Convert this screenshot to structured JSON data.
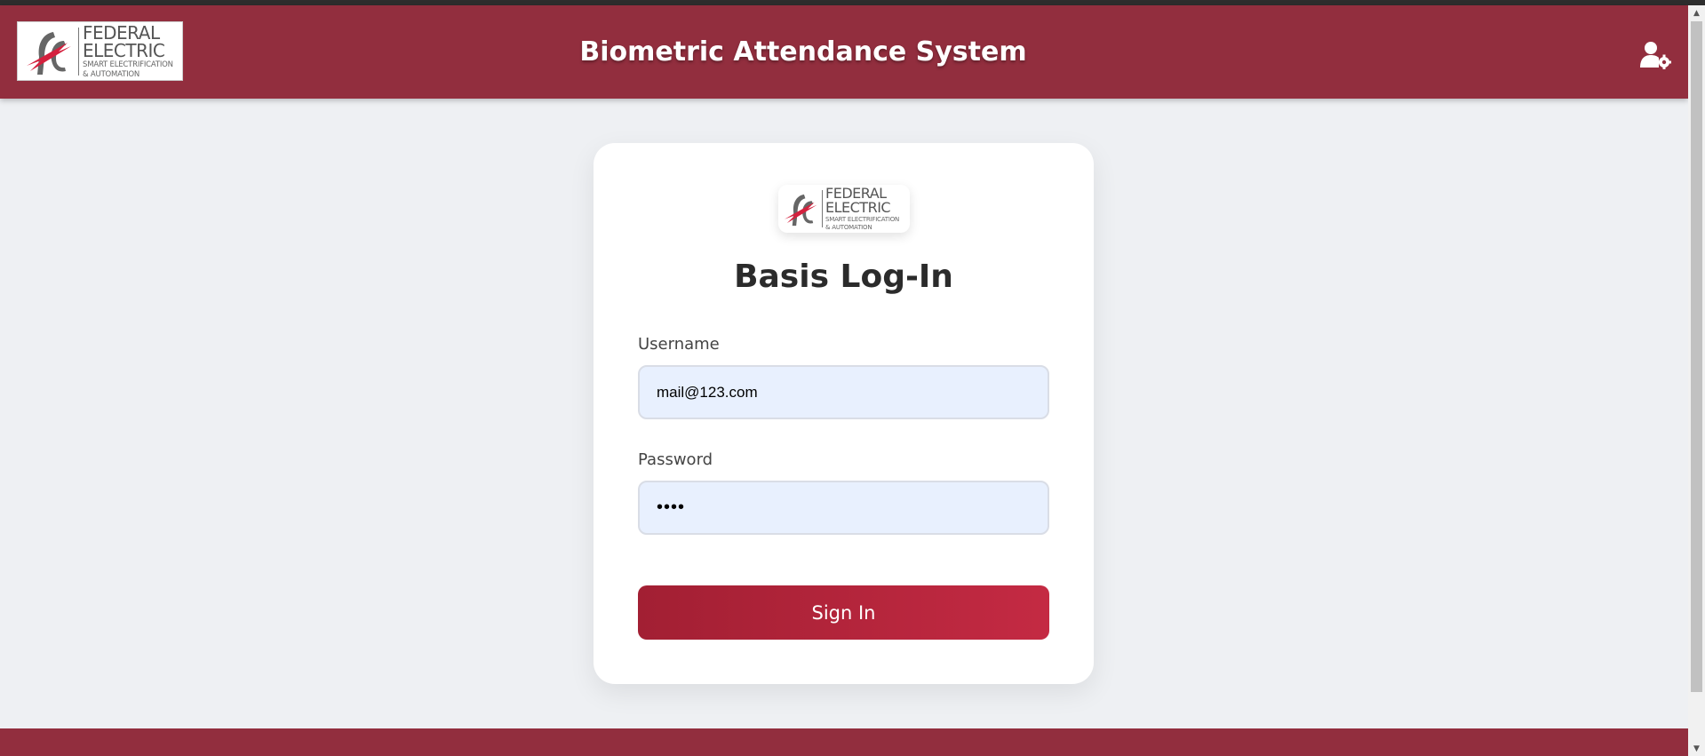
{
  "header": {
    "title": "Biometric Attendance System",
    "logo": {
      "title_line1": "FEDERAL",
      "title_line2": "ELECTRIC",
      "sub_line1": "SMART ELECTRIFICATION",
      "sub_line2": "& AUTOMATION"
    },
    "admin_icon": "user-gear-icon"
  },
  "login": {
    "logo": {
      "title_line1": "FEDERAL",
      "title_line2": "ELECTRIC",
      "sub_line1": "SMART ELECTRIFICATION",
      "sub_line2": "& AUTOMATION"
    },
    "title": "Basis Log-In",
    "username_label": "Username",
    "username_value": "mail@123.com",
    "password_label": "Password",
    "password_value": "••••",
    "signin_label": "Sign In"
  },
  "colors": {
    "brand": "#922e3e",
    "button_start": "#a21f33",
    "button_end": "#c42a43",
    "input_bg": "#e8f0fe"
  }
}
